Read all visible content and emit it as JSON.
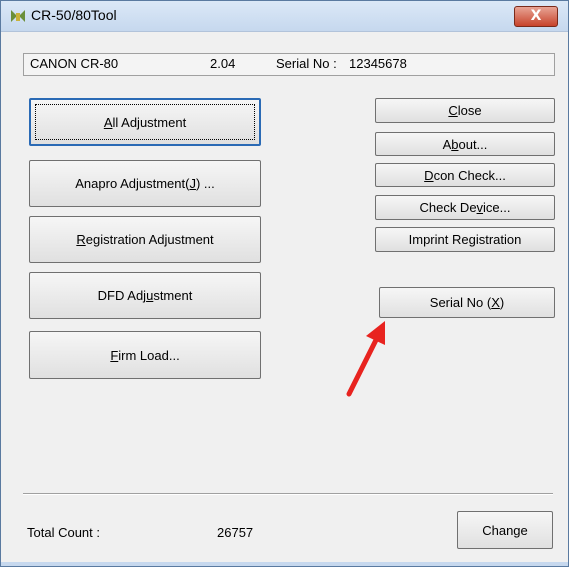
{
  "window": {
    "title": "CR-50/80Tool",
    "close_glyph": "X",
    "icon": "app-icon"
  },
  "info": {
    "model": "CANON  CR-80",
    "version": "2.04",
    "serial_label": "Serial No : ",
    "serial_value": "12345678"
  },
  "left_buttons": {
    "all_adjustment": {
      "pre": "",
      "u": "A",
      "post": "ll Adjustment"
    },
    "anapro": {
      "pre": "Anapro Adjustment(",
      "u": "J",
      "post": ") ..."
    },
    "registration": {
      "pre": "",
      "u": "R",
      "post": "egistration Adjustment"
    },
    "dfd": {
      "pre": "DFD Adj",
      "u": "u",
      "post": "stment"
    },
    "firm_load": {
      "pre": "",
      "u": "F",
      "post": "irm Load..."
    }
  },
  "right_buttons": {
    "close": {
      "pre": "",
      "u": "C",
      "post": "lose"
    },
    "about": {
      "pre": "A",
      "u": "b",
      "post": "out..."
    },
    "dcon": {
      "pre": "",
      "u": "D",
      "post": "con Check..."
    },
    "check_device": {
      "pre": "Check De",
      "u": "v",
      "post": "ice..."
    },
    "imprint": {
      "pre": "Imprint Re",
      "u": "g",
      "post": "istration"
    },
    "serial": {
      "pre": "Serial No (",
      "u": "X",
      "post": ")"
    }
  },
  "footer": {
    "total_count_label": "Total Count :",
    "total_count_value": "26757",
    "change": {
      "pre": "Chan",
      "u": "g",
      "post": "e"
    }
  },
  "colors": {
    "annotation_arrow": "#e8231f",
    "default_button_border": "#2a6ab5"
  }
}
